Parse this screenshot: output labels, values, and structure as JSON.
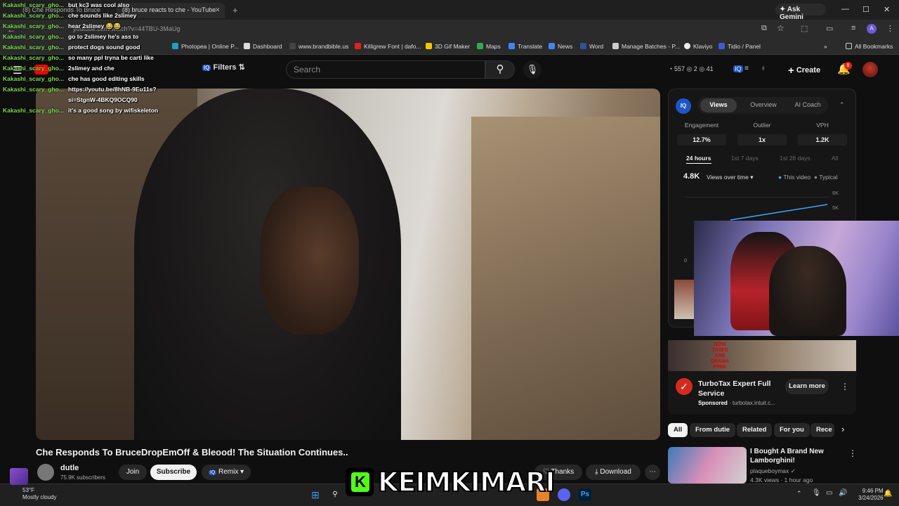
{
  "browser": {
    "tabs": [
      {
        "label": "(8) Che Responds To Bruce"
      },
      {
        "label": "(8) bruce reacts to che - YouTube"
      }
    ],
    "url": "youtube.com/watch?v=44TBU-3MaUg",
    "ask_gemini": "Ask Gemini",
    "bookmarks": [
      "Photopea | Online P...",
      "Dashboard",
      "www.brandbible.us",
      "Killigrew Font | dafo...",
      "3D Gif Maker",
      "Maps",
      "Translate",
      "News",
      "Word",
      "Manage Batches - P...",
      "Klaviyo",
      "Tidio / Panel"
    ],
    "all_bookmarks": "All Bookmarks"
  },
  "youtube": {
    "filters_label": "Filters",
    "search_placeholder": "Search",
    "stats": "557  ◎ 2  ◎ 41",
    "create_label": "Create",
    "notification_count": "8"
  },
  "chat": [
    {
      "user": "Kakashi_scary_gho...",
      "msg": "but kc3 was cool also"
    },
    {
      "user": "Kakashi_scary_gho...",
      "msg": "che sounds like 2slimey"
    },
    {
      "user": "Kakashi_scary_gho...",
      "msg": "hear 2slimey 😂😂"
    },
    {
      "user": "Kakashi_scary_gho...",
      "msg": "go to 2slimey he's ass to"
    },
    {
      "user": "Kakashi_scary_gho...",
      "msg": "protect dogs sound good"
    },
    {
      "user": "Kakashi_scary_gho...",
      "msg": "so many ppl tryna be carti like"
    },
    {
      "user": "Kakashi_scary_gho...",
      "msg": "2slimey and che"
    },
    {
      "user": "Kakashi_scary_gho...",
      "msg": "che has good editing skills"
    },
    {
      "user": "Kakashi_scary_gho...",
      "msg": "https://youtu.be/8hNB-9Eu11s?"
    },
    {
      "user": "",
      "msg": "si=StgnW-4BKQ9OCQ90"
    },
    {
      "user": "Kakashi_scary_gho...",
      "msg": "it's a good song by wifiskeleton"
    }
  ],
  "video": {
    "title": "Che Responds To BruceDropEmOff & Bleood! The Situation Continues..",
    "channel": "dutle",
    "subscribers": "75.9K subscribers",
    "join": "Join",
    "subscribe": "Subscribe",
    "remix": "Remix",
    "thanks": "Thanks",
    "download": "Download"
  },
  "panel": {
    "logo": "IQ",
    "tabs": [
      "Views",
      "Overview",
      "AI Coach"
    ],
    "metrics": [
      {
        "label": "Engagement",
        "value": "12.7%"
      },
      {
        "label": "Outlier",
        "value": "1x"
      },
      {
        "label": "VPH",
        "value": "1.2K"
      }
    ],
    "ranges": [
      "24 hours",
      "1st 7 days",
      "1st 28 days",
      "All"
    ],
    "views": "4.8K",
    "views_dropdown": "Views over time",
    "legend_this": "This video",
    "legend_typical": "Typical",
    "y_ticks": [
      "6K",
      "5K"
    ],
    "y_zero": "0"
  },
  "ad": {
    "banner_text": "NOW TAXES ARE DRAMA FREE",
    "title": "TurboTax Expert Full Service",
    "sponsored": "Sponsored",
    "domain": "turbotax.intuit.c...",
    "cta": "Learn more"
  },
  "chips": [
    "All",
    "From dutie",
    "Related",
    "For you",
    "Rece"
  ],
  "recommended": {
    "title": "I Bought A Brand New Lamborghini!",
    "channel": "plaqueboymax",
    "meta": "4.3K views · 1 hour ago"
  },
  "taskbar": {
    "temp": "53°F",
    "weather": "Mostly cloudy",
    "time": "9:46 PM",
    "date": "3/24/2026"
  },
  "overlay": {
    "kick_name": "KEIMKIMARI"
  }
}
